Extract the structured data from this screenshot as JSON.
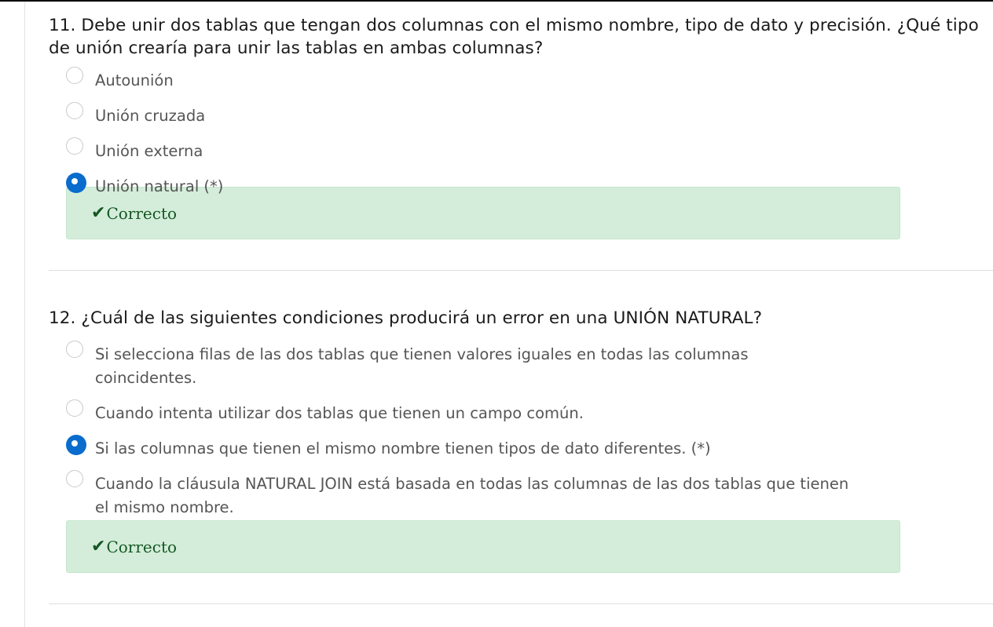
{
  "questions": [
    {
      "text": "11. Debe unir dos tablas que tengan dos columnas con el mismo nombre, tipo de dato y precisión. ¿Qué tipo\nde unión crearía para unir las tablas en ambas columnas?",
      "options": [
        {
          "label": "Autounión",
          "selected": false
        },
        {
          "label": "Unión cruzada",
          "selected": false
        },
        {
          "label": "Unión externa",
          "selected": false
        },
        {
          "label": "Unión natural (*)",
          "selected": true
        }
      ],
      "feedback": "Correcto"
    },
    {
      "text": "12. ¿Cuál de las siguientes condiciones producirá un error en una UNIÓN NATURAL?",
      "options": [
        {
          "label": "Si selecciona filas de las dos tablas que tienen valores iguales en todas las columnas coincidentes.",
          "selected": false
        },
        {
          "label": "Cuando intenta utilizar dos tablas que tienen un campo común.",
          "selected": false
        },
        {
          "label": "Si las columnas que tienen el mismo nombre tienen tipos de dato diferentes. (*)",
          "selected": true
        },
        {
          "label": "Cuando la cláusula NATURAL JOIN está basada en todas las columnas de las dos tablas que tienen el mismo nombre.",
          "selected": false
        }
      ],
      "feedback": "Correcto"
    }
  ],
  "colors": {
    "selected_radio": "#0a6ccc",
    "feedback_bg": "#d4edda",
    "feedback_text": "#155724"
  },
  "icons": {
    "feedback": "check-icon",
    "check_glyph": "✔"
  }
}
